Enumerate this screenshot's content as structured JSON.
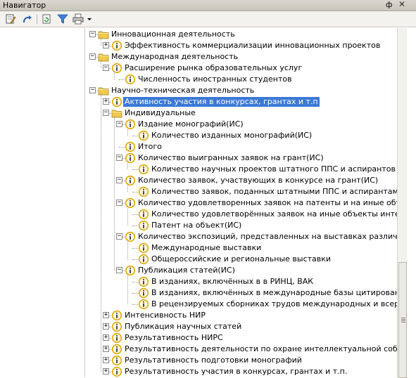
{
  "window": {
    "title": "Навигатор",
    "pin_glyph": "ф",
    "close_glyph": "✕"
  },
  "toolbar": {
    "buttons": [
      {
        "icon": "edit-icon"
      },
      {
        "icon": "redo-icon"
      },
      {
        "icon": "refresh-icon"
      },
      {
        "icon": "filter-icon"
      },
      {
        "icon": "print-icon"
      }
    ]
  },
  "tree": {
    "selected_index": 6,
    "rows": [
      {
        "level": 5,
        "type": "folder",
        "expander": "minus",
        "label": "Инновационная деятельность"
      },
      {
        "level": 6,
        "type": "indicator",
        "expander": "plus",
        "label": "Эффективность коммерциализации инновационных проектов"
      },
      {
        "level": 5,
        "type": "folder",
        "expander": "minus",
        "label": "Международная деятельность"
      },
      {
        "level": 6,
        "type": "indicator",
        "expander": "minus",
        "label": "Расширение рынка образовательных услуг"
      },
      {
        "level": 7,
        "type": "indicator",
        "expander": "none",
        "label": "Численность иностранных студентов"
      },
      {
        "level": 5,
        "type": "folder",
        "expander": "minus",
        "label": "Научно-техническая деятельность"
      },
      {
        "level": 6,
        "type": "indicator",
        "expander": "plus",
        "label": "Активность участия в конкурсах, грантах и т.п"
      },
      {
        "level": 6,
        "type": "folder",
        "expander": "minus",
        "label": "Индивидуальные"
      },
      {
        "level": 7,
        "type": "indicator",
        "expander": "minus",
        "label": "Издание монографий(ИС)"
      },
      {
        "level": 8,
        "type": "indicator",
        "expander": "none",
        "label": "Количество изданных монографий(ИС)"
      },
      {
        "level": 7,
        "type": "indicator",
        "expander": "none",
        "label": "Итого"
      },
      {
        "level": 7,
        "type": "indicator",
        "expander": "minus",
        "label": "Количество выигранных заявок на грант(ИС)"
      },
      {
        "level": 8,
        "type": "indicator",
        "expander": "none",
        "label": "Количество научных проектов штатного ППС и аспирантов факультета,"
      },
      {
        "level": 7,
        "type": "indicator",
        "expander": "minus",
        "label": "Количество заявок, участвующих в конкурсе на грант(ИС)"
      },
      {
        "level": 8,
        "type": "indicator",
        "expander": "none",
        "label": "Количество заявок, поданных штатными ППС и аспирантами факульте"
      },
      {
        "level": 7,
        "type": "indicator",
        "expander": "minus",
        "label": "Количество удовлетворенных заявок на патенты и на иные объекты интел"
      },
      {
        "level": 8,
        "type": "indicator",
        "expander": "none",
        "label": "Количество удовлетворённых заявок на иные объекты интеллектуаль"
      },
      {
        "level": 8,
        "type": "indicator",
        "expander": "none",
        "label": "Патент на объект(ИС)"
      },
      {
        "level": 7,
        "type": "indicator",
        "expander": "minus",
        "label": "Количество экспозиций, представленных на выставках различного уровня"
      },
      {
        "level": 8,
        "type": "indicator",
        "expander": "none",
        "label": "Международные выставки"
      },
      {
        "level": 8,
        "type": "indicator",
        "expander": "none",
        "label": "Общероссийские и региональные выставки"
      },
      {
        "level": 7,
        "type": "indicator",
        "expander": "minus",
        "label": "Публикация статей(ИС)"
      },
      {
        "level": 8,
        "type": "indicator",
        "expander": "none",
        "label": "В изданиях, включённых в в РИНЦ, ВАК"
      },
      {
        "level": 8,
        "type": "indicator",
        "expander": "none",
        "label": "В изданиях, включённых в международные базы цитирования Web of S"
      },
      {
        "level": 8,
        "type": "indicator",
        "expander": "none",
        "label": "В рецензируемых сборниках трудов международных и всероссийских к"
      },
      {
        "level": 6,
        "type": "indicator",
        "expander": "plus",
        "label": "Интенсивность НИР"
      },
      {
        "level": 6,
        "type": "indicator",
        "expander": "plus",
        "label": "Публикация научных статей"
      },
      {
        "level": 6,
        "type": "indicator",
        "expander": "plus",
        "label": "Результативность  НИРС"
      },
      {
        "level": 6,
        "type": "indicator",
        "expander": "plus",
        "label": "Результативность деятельности по охране интеллектуальной собственности"
      },
      {
        "level": 6,
        "type": "indicator",
        "expander": "plus",
        "label": "Результативность подготовки монографий"
      },
      {
        "level": 6,
        "type": "indicator",
        "expander": "plus",
        "label": "Результативность участия в конкурсах, грантах и т.п."
      }
    ]
  },
  "colors": {
    "selection": "#3b79d6",
    "folder": "#f2c94c",
    "indicator": "#e0a800"
  }
}
